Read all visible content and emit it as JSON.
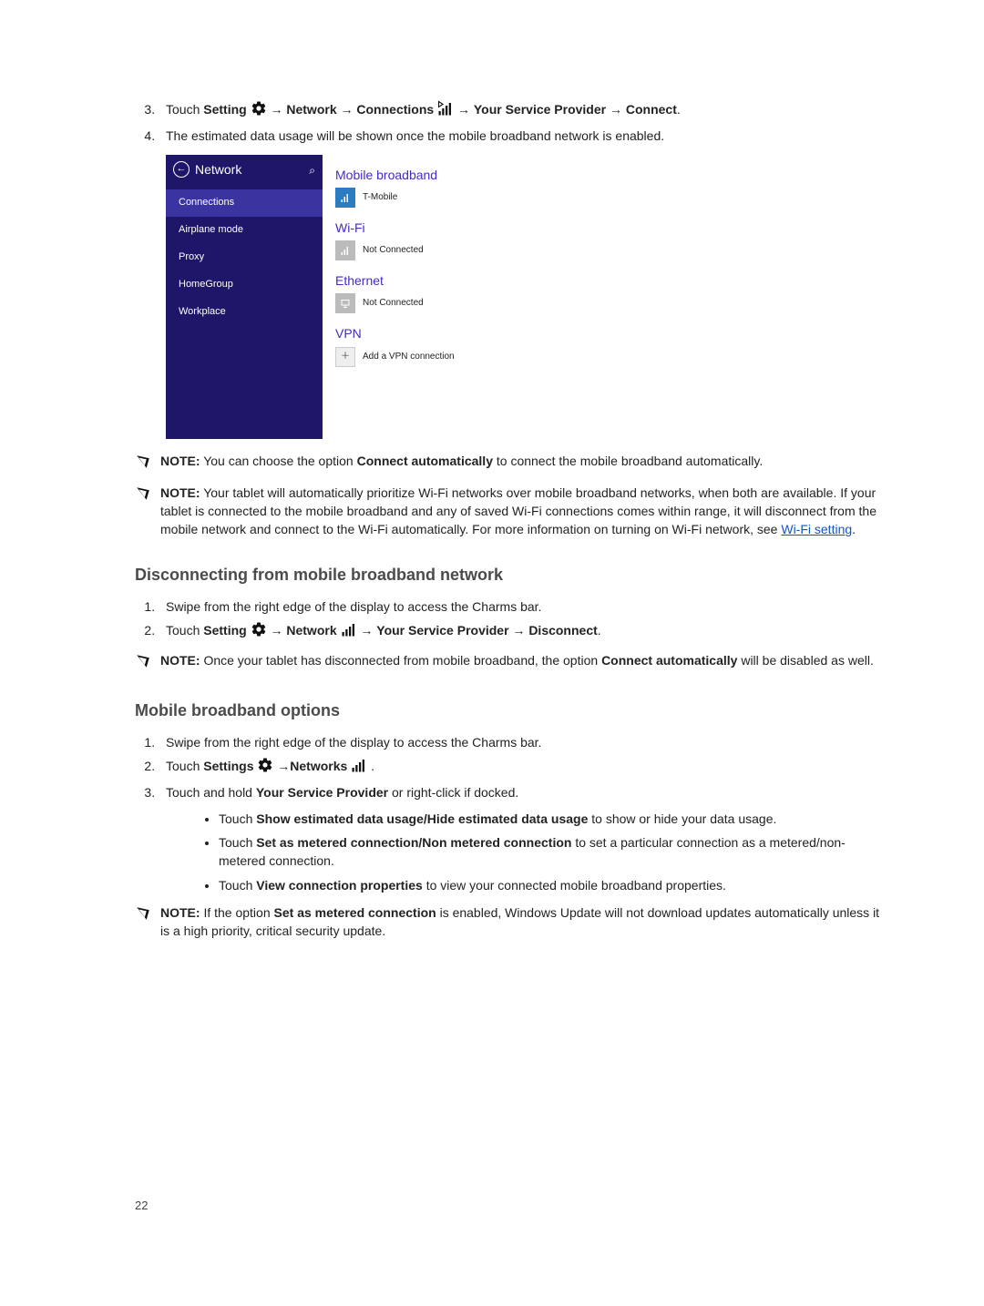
{
  "list1": {
    "step3_prefix": "Touch ",
    "step3_bold_setting": "Setting",
    "step3_arrow": " → ",
    "step3_bold_network": "Network",
    "step3_bold_connections": "Connections",
    "step3_bold_provider": "Your Service Provider",
    "step3_bold_connect": "Connect",
    "step3_period": ".",
    "step4": "The estimated data usage will be shown once the mobile broadband network is enabled."
  },
  "winmock": {
    "back_aria": "back",
    "title": "Network",
    "searchGlyph": "⌕",
    "sidebar": [
      "Connections",
      "Airplane mode",
      "Proxy",
      "HomeGroup",
      "Workplace"
    ],
    "main": {
      "mb_head": "Mobile broadband",
      "mb_name": "T-Mobile",
      "wifi_head": "Wi-Fi",
      "wifi_status": "Not Connected",
      "eth_head": "Ethernet",
      "eth_status": "Not Connected",
      "vpn_head": "VPN",
      "vpn_add": "Add a VPN connection"
    }
  },
  "notes": {
    "n1_strong": "NOTE:",
    "n1a": " You can choose the option ",
    "n1_bold": "Connect automatically",
    "n1b": " to connect the mobile broadband automatically.",
    "n2_strong": "NOTE:",
    "n2a": " Your tablet will automatically prioritize Wi-Fi networks over mobile broadband networks, when both are available. If your tablet is connected to the mobile broadband and any of saved Wi-Fi connections comes within range, it will disconnect from the mobile network and connect to the Wi-Fi automatically. For more information on turning on Wi-Fi network, see ",
    "n2_link": "Wi-Fi setting",
    "n2b": ".",
    "n3_strong": "NOTE:",
    "n3a": " Once your tablet has disconnected from mobile broadband, the option ",
    "n3_bold1": "Connect automatically",
    "n3b": " will be disabled as well.",
    "n4_strong": "NOTE:",
    "n4a": " If the option ",
    "n4_bold": "Set as metered connection",
    "n4b": " is enabled, Windows Update will not download updates automatically unless it is a high priority, critical security update."
  },
  "sec2": {
    "title": "Disconnecting from mobile broadband network",
    "s1": "Swipe from the right edge of the display to access the Charms bar.",
    "s2_prefix": "Touch ",
    "s2_setting": "Setting",
    "s2_network": "Network",
    "s2_provider": "Your Service Provider",
    "s2_disconnect": "Disconnect"
  },
  "sec3": {
    "title": "Mobile broadband options",
    "s1": "Swipe from the right edge of the display to access the Charms bar.",
    "s2_prefix": "Touch ",
    "s2_settings": "Settings",
    "s2_networks": "Networks",
    "s3_pre": "Touch and hold ",
    "s3_bold": "Your Service Provider",
    "s3_post": " or right-click if docked.",
    "b1_pre": "Touch ",
    "b1_bold": "Show estimated data usage/Hide estimated data usage",
    "b1_post": " to show or hide your data usage.",
    "b2_pre": "Touch ",
    "b2_bold": "Set as metered connection/Non metered connection",
    "b2_post": " to set a particular connection as a metered/non-metered connection.",
    "b3_pre": "Touch ",
    "b3_bold": "View connection properties",
    "b3_post": " to view your connected mobile broadband properties."
  },
  "page_number": "22"
}
